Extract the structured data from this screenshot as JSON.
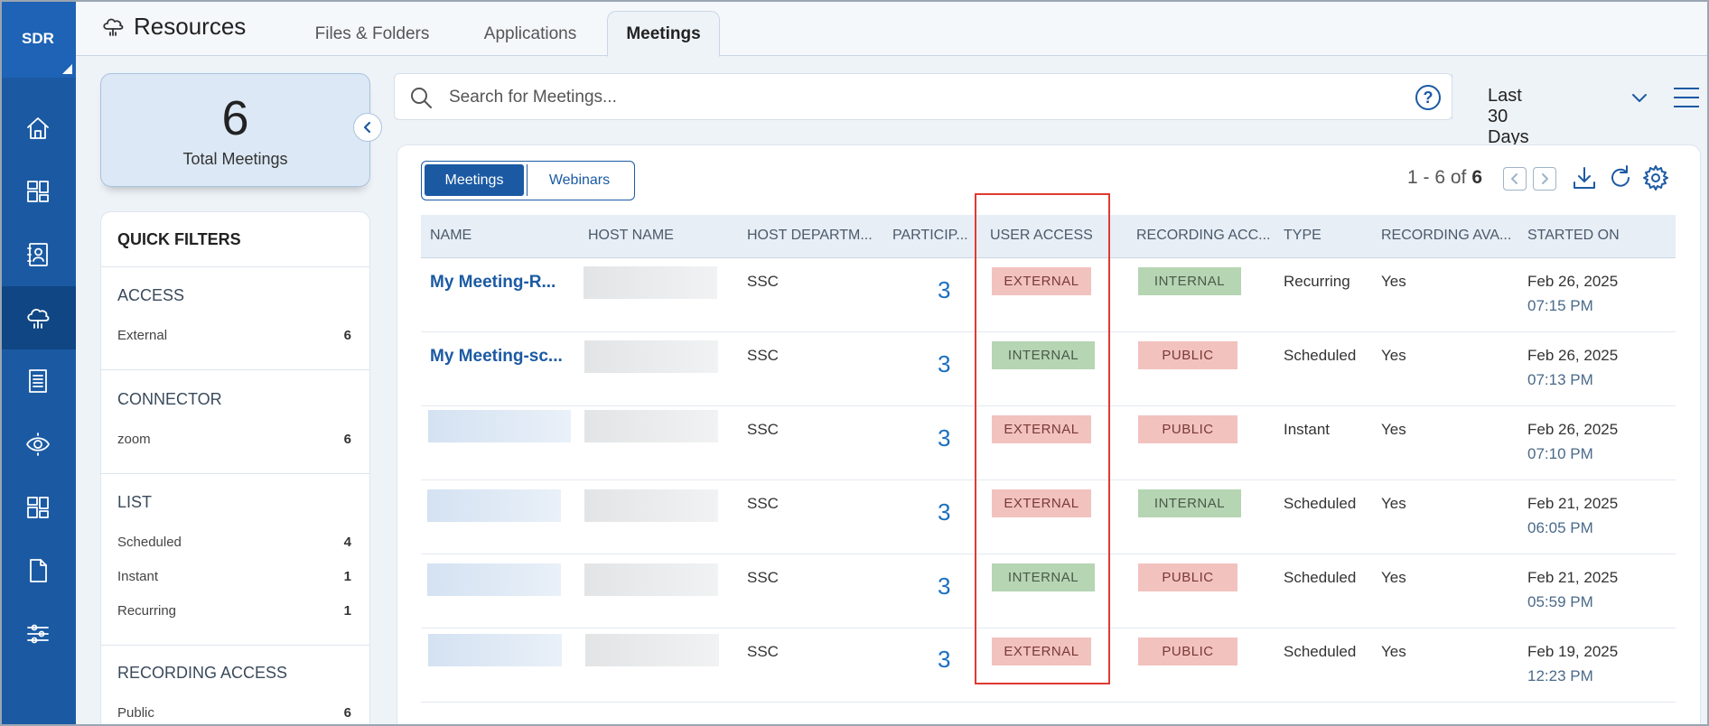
{
  "rail": {
    "logo": "SDR",
    "items": [
      {
        "icon": "home-icon"
      },
      {
        "icon": "dashboard-icon"
      },
      {
        "icon": "contacts-icon"
      },
      {
        "icon": "cloud-resources-icon",
        "active": true
      },
      {
        "icon": "document-list-icon"
      },
      {
        "icon": "eye-scan-icon"
      },
      {
        "icon": "widgets-icon"
      },
      {
        "icon": "file-icon"
      },
      {
        "icon": "sliders-icon"
      }
    ]
  },
  "header": {
    "title": "Resources",
    "tabs": [
      {
        "label": "Files & Folders"
      },
      {
        "label": "Applications"
      },
      {
        "label": "Meetings",
        "active": true
      }
    ]
  },
  "summary": {
    "count": "6",
    "label": "Total Meetings"
  },
  "filters": {
    "title": "QUICK FILTERS",
    "groups": [
      {
        "heading": "ACCESS",
        "items": [
          {
            "label": "External",
            "count": "6"
          }
        ]
      },
      {
        "heading": "CONNECTOR",
        "items": [
          {
            "label": "zoom",
            "count": "6"
          }
        ]
      },
      {
        "heading": "LIST",
        "items": [
          {
            "label": "Scheduled",
            "count": "4"
          },
          {
            "label": "Instant",
            "count": "1"
          },
          {
            "label": "Recurring",
            "count": "1"
          }
        ]
      },
      {
        "heading": "RECORDING ACCESS",
        "items": [
          {
            "label": "Public",
            "count": "6"
          }
        ]
      }
    ]
  },
  "search": {
    "placeholder": "Search for Meetings...",
    "value": "",
    "date_range": "Last 30 Days"
  },
  "toggle": {
    "meetings": "Meetings",
    "webinars": "Webinars",
    "selected": "Meetings"
  },
  "pager": {
    "range": "1 - 6 of",
    "total": "6"
  },
  "table": {
    "columns": [
      "NAME",
      "HOST NAME",
      "HOST DEPARTM...",
      "PARTICIP...",
      "USER ACCESS",
      "RECORDING ACC...",
      "TYPE",
      "RECORDING AVA...",
      "STARTED ON"
    ],
    "rows": [
      {
        "name": "My Meeting-R...",
        "dept": "SSC",
        "participants": "3",
        "user_access": "EXTERNAL",
        "recording_access": "INTERNAL",
        "type": "Recurring",
        "recording_available": "Yes",
        "date": "Feb 26, 2025",
        "time": "07:15 PM"
      },
      {
        "name": "My Meeting-sc...",
        "dept": "SSC",
        "participants": "3",
        "user_access": "INTERNAL",
        "recording_access": "PUBLIC",
        "type": "Scheduled",
        "recording_available": "Yes",
        "date": "Feb 26, 2025",
        "time": "07:13 PM"
      },
      {
        "name": "",
        "dept": "SSC",
        "participants": "3",
        "user_access": "EXTERNAL",
        "recording_access": "PUBLIC",
        "type": "Instant",
        "recording_available": "Yes",
        "date": "Feb 26, 2025",
        "time": "07:10 PM"
      },
      {
        "name": "",
        "dept": "SSC",
        "participants": "3",
        "user_access": "EXTERNAL",
        "recording_access": "INTERNAL",
        "type": "Scheduled",
        "recording_available": "Yes",
        "date": "Feb 21, 2025",
        "time": "06:05 PM"
      },
      {
        "name": "",
        "dept": "SSC",
        "participants": "3",
        "user_access": "INTERNAL",
        "recording_access": "PUBLIC",
        "type": "Scheduled",
        "recording_available": "Yes",
        "date": "Feb 21, 2025",
        "time": "05:59 PM"
      },
      {
        "name": "",
        "dept": "SSC",
        "participants": "3",
        "user_access": "EXTERNAL",
        "recording_access": "PUBLIC",
        "type": "Scheduled",
        "recording_available": "Yes",
        "date": "Feb 19, 2025",
        "time": "12:23 PM"
      }
    ]
  },
  "colors": {
    "brand": "#1b5aa3",
    "external_badge": "#f2c2bf",
    "internal_badge": "#b6d5b3",
    "highlight": "#e03a32"
  }
}
